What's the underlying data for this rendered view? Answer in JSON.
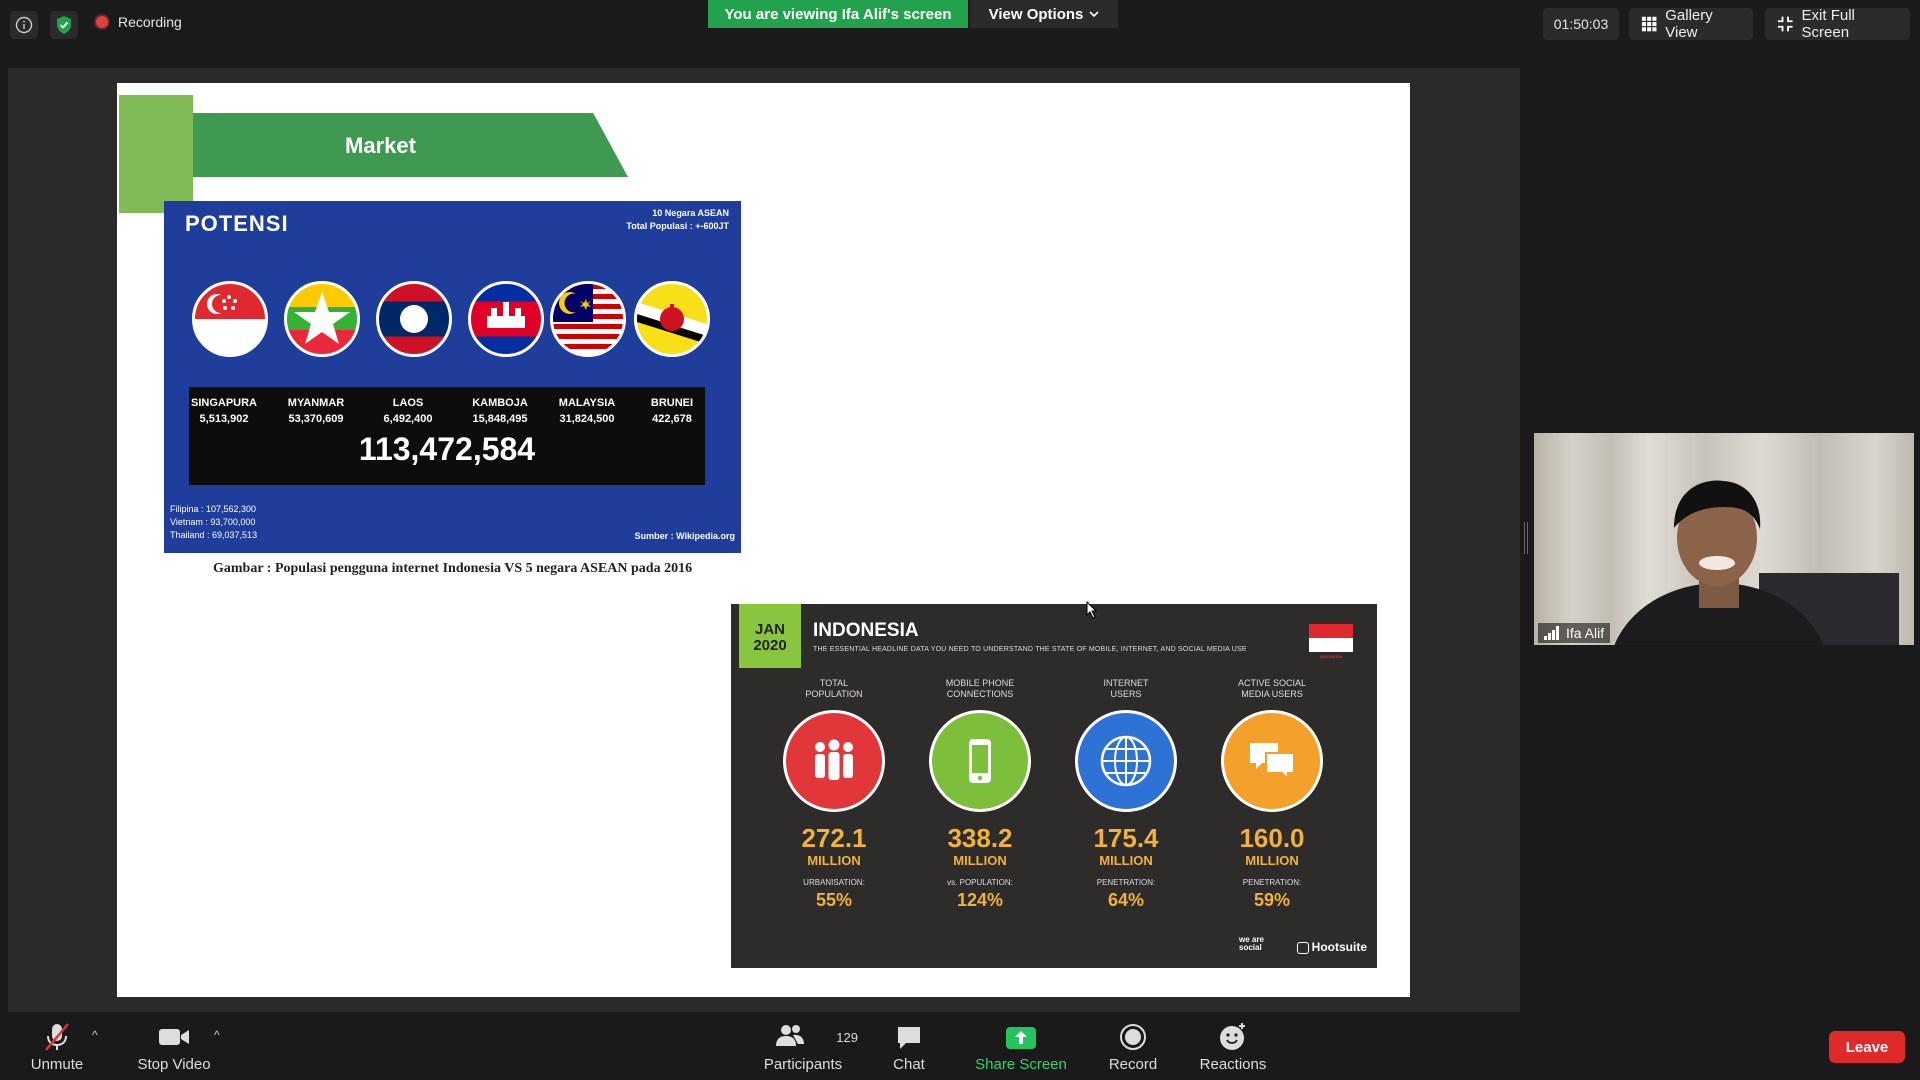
{
  "topbar": {
    "recording_label": "Recording",
    "viewing_banner": "You are viewing Ifa Alif's screen",
    "view_options": "View Options",
    "timer": "01:50:03",
    "gallery_view": "Gallery View",
    "exit_full_screen": "Exit Full Screen"
  },
  "slide": {
    "header": "Market",
    "potensi": {
      "title": "POTENSI",
      "subtitle_line1": "10 Negara ASEAN",
      "subtitle_line2": "Total Populasi : +-600JT",
      "countries": [
        {
          "name": "SINGAPURA",
          "population": "5,513,902"
        },
        {
          "name": "MYANMAR",
          "population": "53,370,609"
        },
        {
          "name": "LAOS",
          "population": "6,492,400"
        },
        {
          "name": "KAMBOJA",
          "population": "15,848,495"
        },
        {
          "name": "MALAYSIA",
          "population": "31,824,500"
        },
        {
          "name": "BRUNEI",
          "population": "422,678"
        }
      ],
      "total": "113,472,584",
      "others": [
        "Filipina : 107,562,300",
        "Vietnam : 93,700,000",
        "Thailand : 69,037,513"
      ],
      "source": "Sumber : Wikipedia.org"
    },
    "caption": "Gambar : Populasi pengguna internet Indonesia VS 5 negara ASEAN pada 2016",
    "indonesia": {
      "date_line1": "JAN",
      "date_line2": "2020",
      "title": "INDONESIA",
      "subtitle": "THE ESSENTIAL HEADLINE DATA YOU NEED TO UNDERSTAND THE STATE OF MOBILE, INTERNET, AND SOCIAL MEDIA USE",
      "flag_label": "INDONESIA",
      "stats": [
        {
          "label_line1": "TOTAL",
          "label_line2": "POPULATION",
          "value": "272.1",
          "unit": "MILLION",
          "sublabel": "URBANISATION:",
          "pct": "55%",
          "color": "#e2373a"
        },
        {
          "label_line1": "MOBILE PHONE",
          "label_line2": "CONNECTIONS",
          "value": "338.2",
          "unit": "MILLION",
          "sublabel": "vs. POPULATION:",
          "pct": "124%",
          "color": "#7bbf3a"
        },
        {
          "label_line1": "INTERNET",
          "label_line2": "USERS",
          "value": "175.4",
          "unit": "MILLION",
          "sublabel": "PENETRATION:",
          "pct": "64%",
          "color": "#2f72d6"
        },
        {
          "label_line1": "ACTIVE SOCIAL",
          "label_line2": "MEDIA USERS",
          "value": "160.0",
          "unit": "MILLION",
          "sublabel": "PENETRATION:",
          "pct": "59%",
          "color": "#f3a12b"
        }
      ],
      "brand_we_are_social": "we are social",
      "brand_hootsuite": "Hootsuite"
    }
  },
  "video": {
    "participant_name": "Ifa Alif"
  },
  "toolbar": {
    "unmute": "Unmute",
    "stop_video": "Stop Video",
    "participants": "Participants",
    "participants_count": "129",
    "chat": "Chat",
    "share_screen": "Share Screen",
    "record": "Record",
    "reactions": "Reactions",
    "leave": "Leave"
  }
}
